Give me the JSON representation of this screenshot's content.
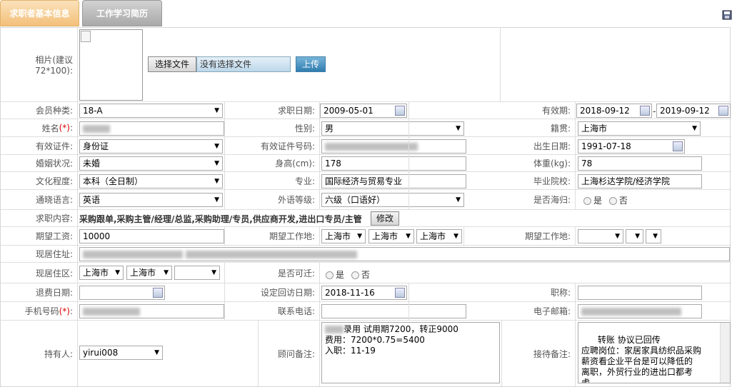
{
  "tabs": {
    "basic": "求职者基本信息",
    "history": "工作学习简历"
  },
  "photo": {
    "label": "相片(建议72*100):",
    "choose_file": "选择文件",
    "no_file": "没有选择文件",
    "upload": "上传"
  },
  "member_type": {
    "label": "会员种类:",
    "value": "18-A"
  },
  "apply_date": {
    "label": "求职日期:",
    "value": "2009-05-01"
  },
  "valid_period": {
    "label": "有效期:",
    "from": "2018-09-12",
    "sep": "-",
    "to": "2019-09-12"
  },
  "name": {
    "label": "姓名",
    "req": "(*)",
    "colon": ":"
  },
  "gender": {
    "label": "性别:",
    "value": "男"
  },
  "origin": {
    "label": "籍贯:",
    "value": "上海市"
  },
  "id_type": {
    "label": "有效证件:",
    "value": "身份证"
  },
  "id_number": {
    "label": "有效证件号码:"
  },
  "birth": {
    "label": "出生日期:",
    "value": "1991-07-18"
  },
  "marital": {
    "label": "婚姻状况:",
    "value": "未婚"
  },
  "height": {
    "label": "身高(cm):",
    "value": "178"
  },
  "weight": {
    "label": "体重(kg):",
    "value": "78"
  },
  "education": {
    "label": "文化程度:",
    "value": "本科（全日制）"
  },
  "major": {
    "label": "专业:",
    "value": "国际经济与贸易专业"
  },
  "school": {
    "label": "毕业院校:",
    "value": "上海杉达学院/经济学院"
  },
  "language": {
    "label": "通晓语言:",
    "value": "英语"
  },
  "lang_level": {
    "label": "外语等级:",
    "value": "六级（口语好）"
  },
  "returnee": {
    "label": "是否海归:",
    "yes": "是",
    "no": "否"
  },
  "job_content": {
    "label": "求职内容:",
    "value": "采购跟单,采购主管/经理/总监,采购助理/专员,供应商开发,进出口专员/主管",
    "edit": "修改"
  },
  "expected_salary": {
    "label": "期望工资:",
    "value": "10000"
  },
  "expected_location": {
    "label": "期望工作地:",
    "v1": "上海市",
    "v2": "上海市",
    "v3": "上海市"
  },
  "expected_location2": {
    "label": "期望工作地:"
  },
  "address": {
    "label": "现居住址:"
  },
  "district": {
    "label": "现居住区:",
    "v1": "上海市",
    "v2": "上海市"
  },
  "relocate": {
    "label": "是否可迁:",
    "yes": "是",
    "no": "否"
  },
  "refund_date": {
    "label": "退费日期:"
  },
  "callback_date": {
    "label": "设定回访日期:",
    "value": "2018-11-16"
  },
  "title": {
    "label": "职称:"
  },
  "mobile": {
    "label": "手机号码",
    "req": "(*)",
    "colon": ":"
  },
  "phone": {
    "label": "联系电话:"
  },
  "email": {
    "label": "电子邮箱:"
  },
  "holder": {
    "label": "持有人:",
    "value": "yirui008"
  },
  "consultant_note": {
    "label": "顾问备注:",
    "value": "录用 试用期7200，转正9000\n费用：7200*0.75=5400\n入职：11-19"
  },
  "reception_note": {
    "label": "接待备注:",
    "value": "转账 协议已回传\n应聘岗位：家居家具纺织品采购\n薪资看企业平台是可以降低的\n离职，外贸行业的进出口都考\n虑。"
  }
}
